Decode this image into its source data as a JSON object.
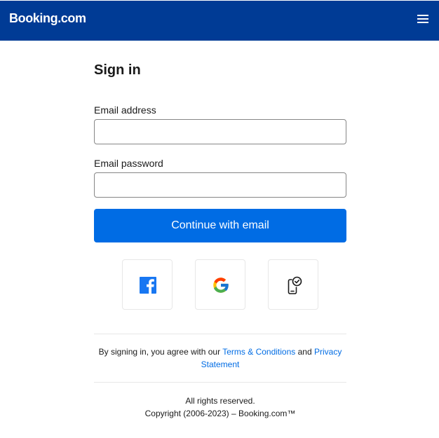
{
  "header": {
    "logo_text": "Booking.com",
    "menu_icon": "hamburger-menu-icon",
    "background_color": "#003b95"
  },
  "signin": {
    "title": "Sign in",
    "email_label": "Email address",
    "email_value": "",
    "password_label": "Email password",
    "password_value": "",
    "continue_label": "Continue with email",
    "accent_color": "#006ce4"
  },
  "social": [
    {
      "name": "facebook",
      "icon": "facebook-icon"
    },
    {
      "name": "google",
      "icon": "google-icon"
    },
    {
      "name": "device",
      "icon": "phone-check-icon"
    }
  ],
  "terms": {
    "prefix": "By signing in, you agree with our ",
    "terms_link": "Terms & Conditions",
    "and": " and ",
    "privacy_link": "Privacy Statement"
  },
  "footer": {
    "rights": "All rights reserved.",
    "copyright": "Copyright (2006-2023) – Booking.com™"
  }
}
